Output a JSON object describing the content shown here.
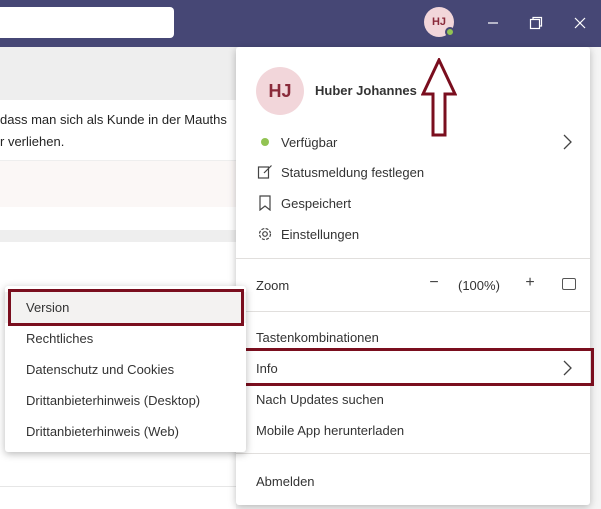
{
  "titlebar": {
    "avatar_initials": "HJ",
    "presence": "available",
    "minimize_icon": "minimize-icon",
    "restore_icon": "restore-icon",
    "close_icon": "close-icon"
  },
  "background": {
    "text_line1": "dass man sich als Kunde in der Mauths",
    "text_line2": "r verliehen."
  },
  "profile_menu": {
    "avatar_initials": "HJ",
    "user_name": "Huber Johannes",
    "status_label": "Verfügbar",
    "status_message_label": "Statusmeldung festlegen",
    "saved_label": "Gespeichert",
    "settings_label": "Einstellungen",
    "zoom_label": "Zoom",
    "zoom_minus": "−",
    "zoom_value": "(100%)",
    "zoom_plus": "+",
    "shortcuts_label": "Tastenkombinationen",
    "info_label": "Info",
    "updates_label": "Nach Updates suchen",
    "mobile_app_label": "Mobile App herunterladen",
    "signout_label": "Abmelden"
  },
  "info_submenu": {
    "items": [
      {
        "label": "Version"
      },
      {
        "label": "Rechtliches"
      },
      {
        "label": "Datenschutz und Cookies"
      },
      {
        "label": "Drittanbieterhinweis (Desktop)"
      },
      {
        "label": "Drittanbieterhinweis (Web)"
      }
    ]
  },
  "colors": {
    "titlebar": "#464775",
    "highlight": "#7a0e1e",
    "presence_green": "#92c353",
    "avatar_bg": "#f2d6da"
  }
}
